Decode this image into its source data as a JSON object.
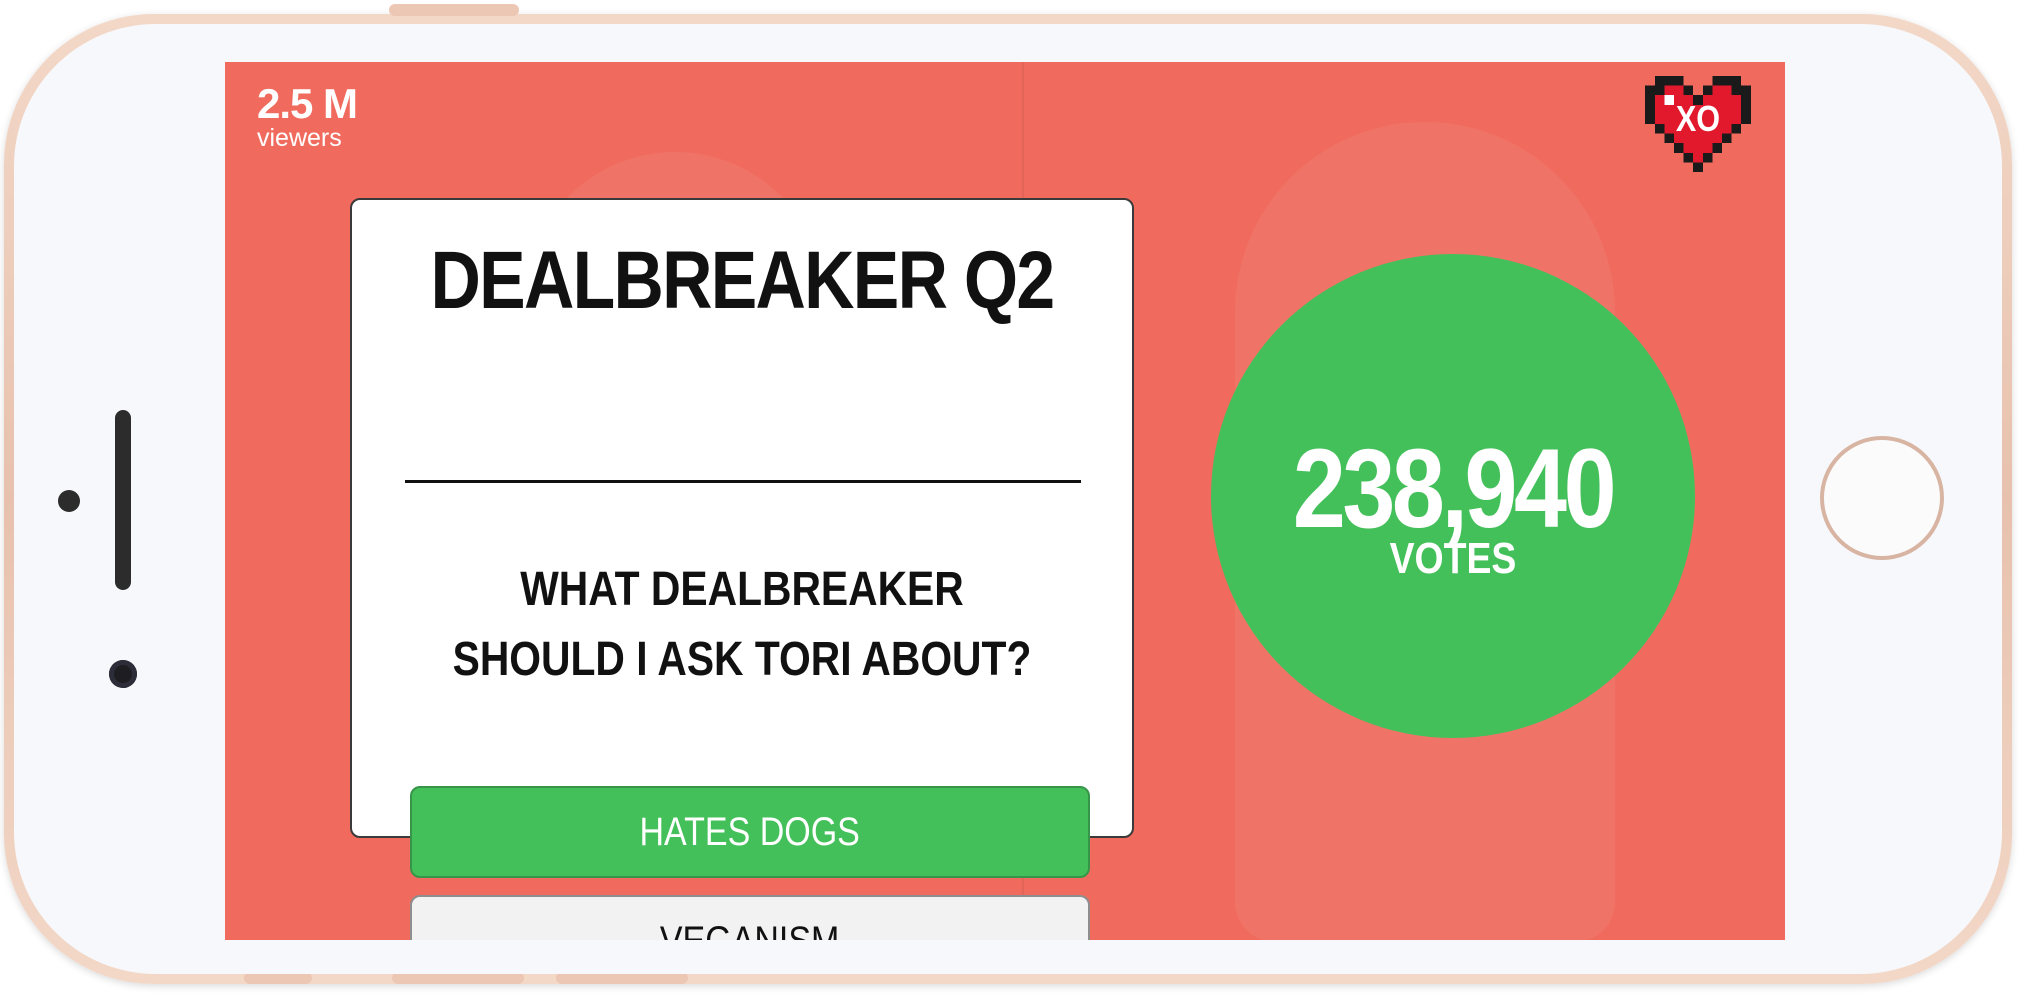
{
  "stream": {
    "viewer_count": "2.5 M",
    "viewer_label": "viewers",
    "badge_text": "XO"
  },
  "poll": {
    "title": "DEALBREAKER Q2",
    "question": "WHAT DEALBREAKER SHOULD I ASK TORI ABOUT?",
    "options": [
      {
        "label": "HATES DOGS",
        "selected": true
      },
      {
        "label": "VEGANISM",
        "selected": false
      }
    ]
  },
  "votes": {
    "count": "238,940",
    "label": "VOTES"
  },
  "colors": {
    "screen_background": "#f06b5e",
    "accent_green": "#44c05a",
    "heart_red": "#e2192d"
  },
  "icons": {
    "badge": "pixel-heart-icon"
  }
}
